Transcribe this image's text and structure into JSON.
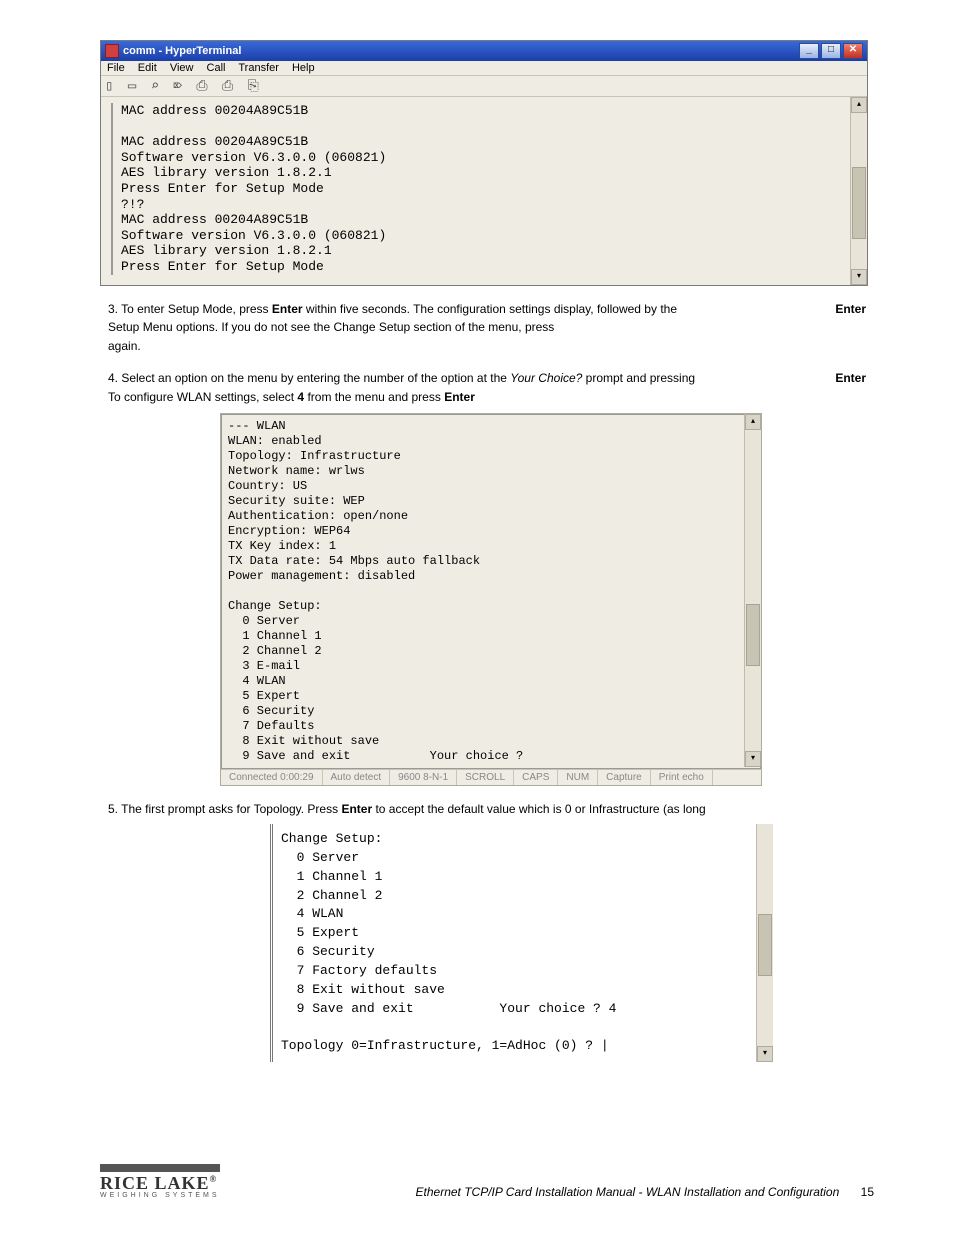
{
  "win1": {
    "title": "comm - HyperTerminal",
    "menus": [
      "File",
      "Edit",
      "View",
      "Call",
      "Transfer",
      "Help"
    ],
    "toolbar_glyphs": "▯ ▭  ⌕ ⌦  ⎙ ⎙  ⎘",
    "term_lines": "MAC address 00204A89C51B\n\nMAC address 00204A89C51B\nSoftware version V6.3.0.0 (060821)\nAES library version 1.8.2.1\nPress Enter for Setup Mode\n?!?\nMAC address 00204A89C51B\nSoftware version V6.3.0.0 (060821)\nAES library version 1.8.2.1\nPress Enter for Setup Mode"
  },
  "instr_block_a": {
    "t1a": "3. To enter Setup Mode, press ",
    "t1b": "Enter",
    "t1c": " within five seconds. The configuration settings display, followed by the ",
    "t1d": "Enter",
    "t2": "   Setup Menu options. If you do not see the Change Setup section of the menu, press ",
    "t3": "   again."
  },
  "instr_block_b": {
    "t1a": "4. Select an option on the menu by entering the number of the option at the ",
    "t1b": "Your Choice?",
    "t1c": " prompt and pressing ",
    "t1d": "Enter",
    "t2a": "   To configure WLAN settings, select ",
    "t2b": "4",
    "t2c": " from the menu and press ",
    "t2d": "Enter"
  },
  "win2": {
    "term_lines": "--- WLAN\nWLAN: enabled\nTopology: Infrastructure\nNetwork name: wrlws\nCountry: US\nSecurity suite: WEP\nAuthentication: open/none\nEncryption: WEP64\nTX Key index: 1\nTX Data rate: 54 Mbps auto fallback\nPower management: disabled\n\nChange Setup:\n  0 Server\n  1 Channel 1\n  2 Channel 2\n  3 E-mail\n  4 WLAN\n  5 Expert\n  6 Security\n  7 Defaults\n  8 Exit without save\n  9 Save and exit           Your choice ?",
    "status": [
      "Connected 0:00:29",
      "Auto detect",
      "9600 8-N-1",
      "SCROLL",
      "CAPS",
      "NUM",
      "Capture",
      "Print echo"
    ]
  },
  "instr_block_c": {
    "t1a": "5. The first prompt asks for Topology. Press ",
    "t1b": "Enter",
    "t1c": " to accept the default value which is 0 or Infrastructure (as long"
  },
  "win3": {
    "term_lines": "Change Setup:\n  0 Server\n  1 Channel 1\n  2 Channel 2\n  4 WLAN\n  5 Expert\n  6 Security\n  7 Factory defaults\n  8 Exit without save\n  9 Save and exit           Your choice ? 4\n\nTopology 0=Infrastructure, 1=AdHoc (0) ? |"
  },
  "footer": {
    "brand_main": "RICE LAKE",
    "brand_sub": "WEIGHING SYSTEMS",
    "doc_title": "Ethernet TCP/IP Card Installation Manual - WLAN Installation and Configuration",
    "page": "15"
  }
}
